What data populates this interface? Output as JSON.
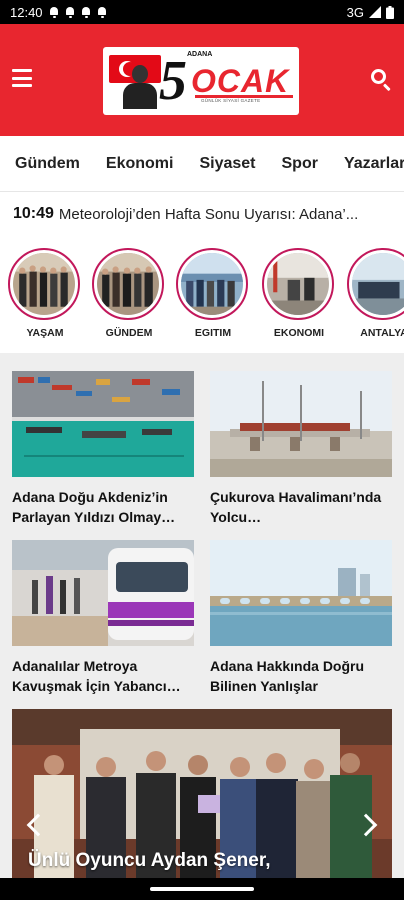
{
  "status_bar": {
    "time": "12:40",
    "network": "3G"
  },
  "header": {
    "logo": {
      "top": "ADANA",
      "number": "5",
      "name": "OCAK",
      "slogan": "GÜNLÜK SİYASİ GAZETE"
    }
  },
  "categories": [
    "Gündem",
    "Ekonomi",
    "Siyaset",
    "Spor",
    "Yazarlar"
  ],
  "ticker": {
    "time": "10:49",
    "text": "Meteoroloji’den Hafta Sonu Uyarısı: Adana’..."
  },
  "stories": [
    {
      "label": "YAŞAM"
    },
    {
      "label": "GÜNDEM"
    },
    {
      "label": "EGITIM"
    },
    {
      "label": "EKONOMI"
    },
    {
      "label": "ANTALYA"
    }
  ],
  "articles": [
    {
      "title": "Adana Doğu Akdeniz’in Parlayan Yıldızı Olmay…"
    },
    {
      "title": "Çukurova Havalimanı’nda Yolcu…"
    },
    {
      "title": "Adanalılar Metroya Kavuşmak İçin Yabancı…"
    },
    {
      "title": "Adana Hakkında Doğru Bilinen Yanlışlar"
    }
  ],
  "featured": {
    "caption": "Ünlü Oyuncu Aydan Şener,"
  },
  "colors": {
    "brand_red": "#e8262f",
    "story_ring": "#c2185b",
    "feed_bg": "#eeeeee"
  }
}
